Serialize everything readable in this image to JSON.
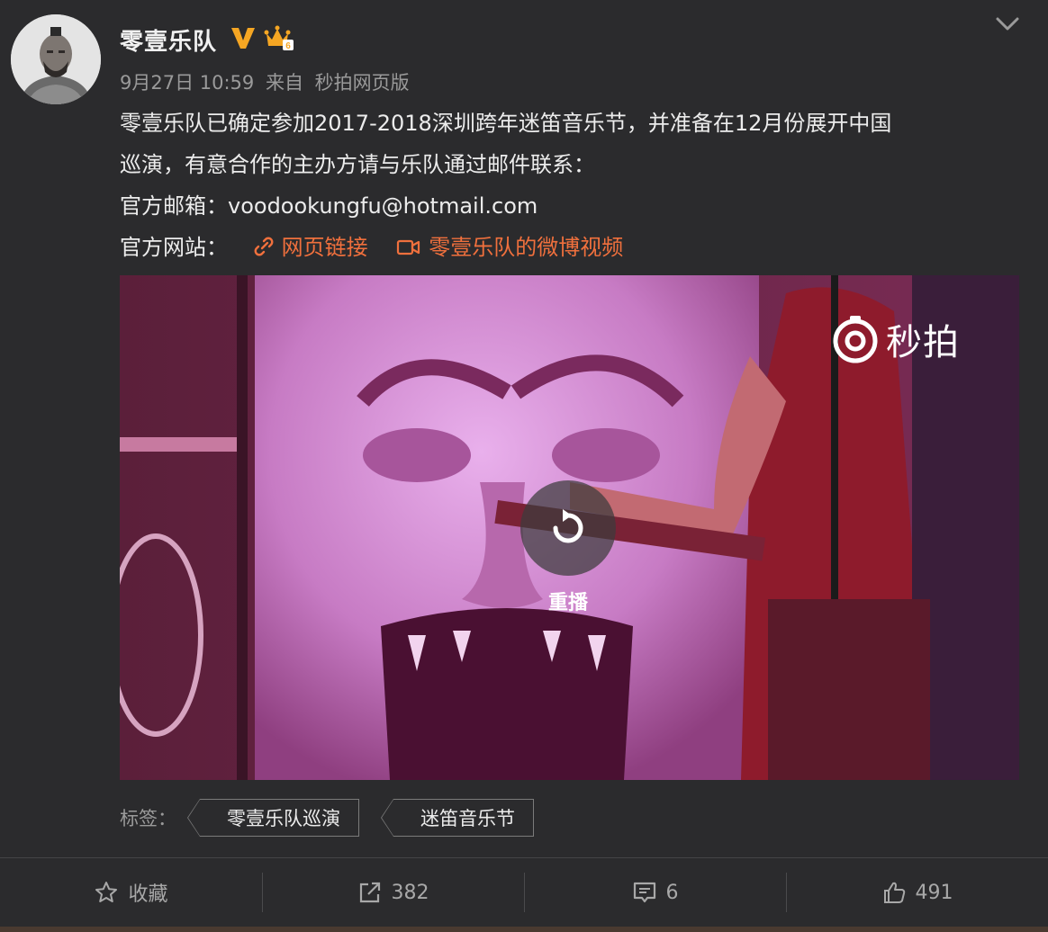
{
  "post": {
    "author": "零壹乐队",
    "time": "9月27日 10:59",
    "source_prefix": "来自",
    "source": "秒拍网页版",
    "text_line1": "零壹乐队已确定参加2017-2018深圳跨年迷笛音乐节，并准备在12月份展开中国",
    "text_line2": "巡演，有意合作的主办方请与乐队通过邮件联系：",
    "email_label": "官方邮箱：",
    "email": "voodookungfu@hotmail.com",
    "website_label": "官方网站：",
    "link_webpage": "网页链接",
    "link_video": "零壹乐队的微博视频",
    "icons": {
      "verified": "verified-v-icon",
      "crown": "vip-crown-icon",
      "more": "chevron-down-icon",
      "link": "link-icon",
      "video": "video-camera-icon"
    }
  },
  "video": {
    "watermark": "秒拍",
    "replay_label": "重播"
  },
  "tags": {
    "label": "标签：",
    "items": [
      "零壹乐队巡演",
      "迷笛音乐节"
    ]
  },
  "actions": {
    "favorite": "收藏",
    "repost": "382",
    "comment": "6",
    "like": "491"
  },
  "colors": {
    "background": "#2b2b2d",
    "link": "#f0703d",
    "verified": "#f5a623"
  }
}
